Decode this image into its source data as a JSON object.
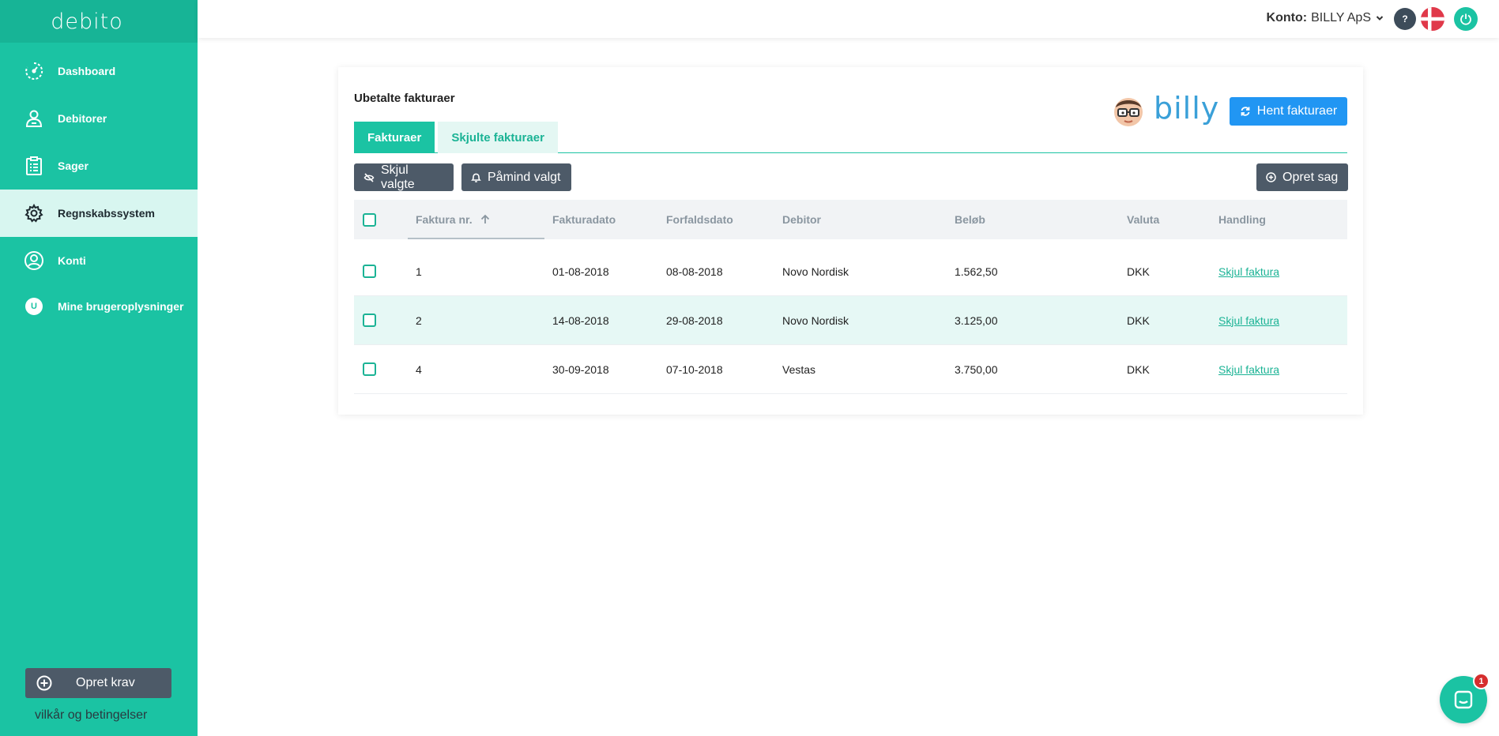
{
  "sidebar": {
    "logo": "debito",
    "items": [
      {
        "label": "Dashboard",
        "icon": "dashboard-icon"
      },
      {
        "label": "Debitorer",
        "icon": "debtor-icon"
      },
      {
        "label": "Sager",
        "icon": "clipboard-icon"
      },
      {
        "label": "Regnskabssystem",
        "icon": "gear-icon",
        "active": true
      },
      {
        "label": "Konti",
        "icon": "user-circle-icon"
      },
      {
        "label": "Mine brugeroplysninger",
        "icon": "user-badge-icon",
        "badge": "U"
      }
    ],
    "create_claim": "Opret krav",
    "terms": "vilkår og betingelser"
  },
  "topbar": {
    "account_label": "Konto:",
    "account_name": "BILLY ApS",
    "help": "?"
  },
  "card": {
    "title": "Ubetalte fakturaer",
    "integration_logo": "billy",
    "fetch_button": "Hent fakturaer",
    "tabs": [
      {
        "label": "Fakturaer",
        "active": true
      },
      {
        "label": "Skjulte fakturaer",
        "active": false
      }
    ],
    "actions": {
      "hide_selected": "Skjul valgte",
      "remind_selected": "Påmind valgt",
      "create_case": "Opret sag"
    },
    "table": {
      "headers": {
        "nr": "Faktura nr.",
        "invoice_date": "Fakturadato",
        "due_date": "Forfaldsdato",
        "debtor": "Debitor",
        "amount": "Beløb",
        "currency": "Valuta",
        "action": "Handling"
      },
      "rows": [
        {
          "nr": "1",
          "invoice_date": "01-08-2018",
          "due_date": "08-08-2018",
          "debtor": "Novo Nordisk",
          "amount": "1.562,50",
          "currency": "DKK",
          "action": "Skjul faktura"
        },
        {
          "nr": "2",
          "invoice_date": "14-08-2018",
          "due_date": "29-08-2018",
          "debtor": "Novo Nordisk",
          "amount": "3.125,00",
          "currency": "DKK",
          "action": "Skjul faktura"
        },
        {
          "nr": "4",
          "invoice_date": "30-09-2018",
          "due_date": "07-10-2018",
          "debtor": "Vestas",
          "amount": "3.750,00",
          "currency": "DKK",
          "action": "Skjul faktura"
        }
      ]
    }
  },
  "chat": {
    "badge": "1"
  },
  "colors": {
    "brand": "#1bc3a3",
    "sidebar_active_bg": "#d8f6f0",
    "dark_button": "#4d5a68",
    "primary_button": "#2196f3",
    "danger_badge": "#d62e2e"
  }
}
